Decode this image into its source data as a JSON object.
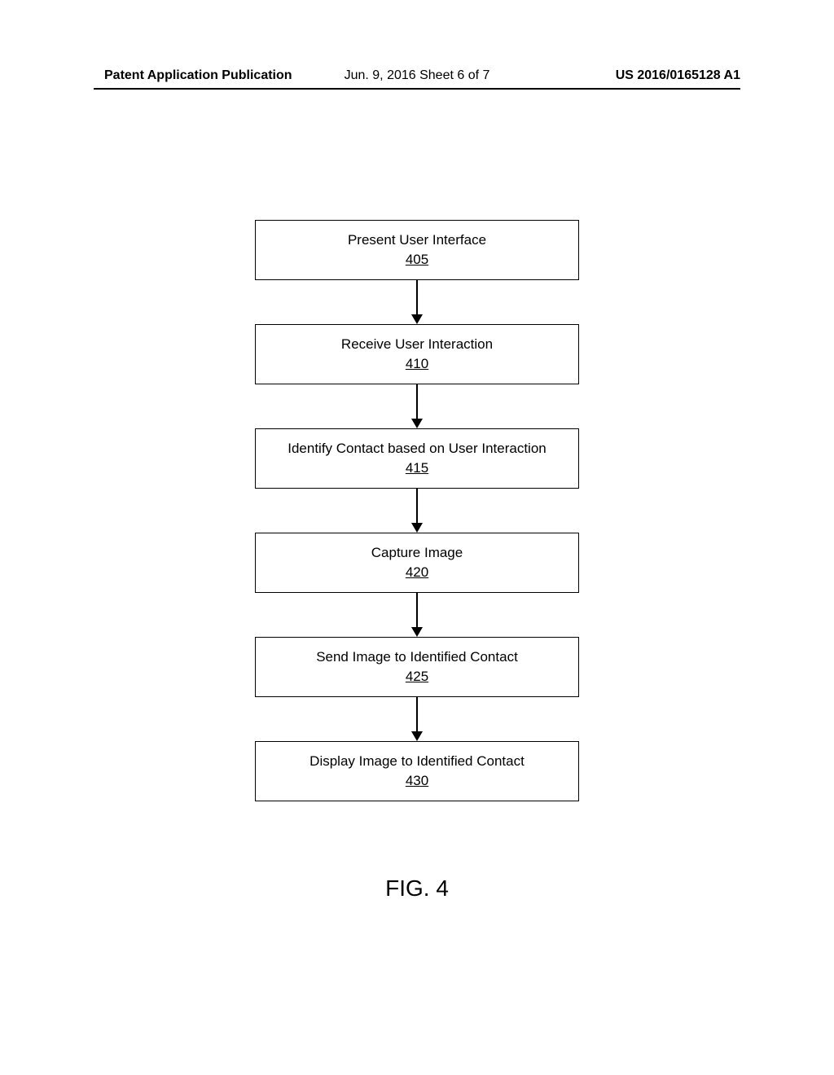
{
  "header": {
    "left": "Patent Application Publication",
    "center": "Jun. 9, 2016  Sheet 6 of 7",
    "right": "US 2016/0165128 A1"
  },
  "flowchart": {
    "steps": [
      {
        "label": "Present User Interface",
        "ref": "405"
      },
      {
        "label": "Receive User Interaction",
        "ref": "410"
      },
      {
        "label": "Identify Contact based on User Interaction",
        "ref": "415"
      },
      {
        "label": "Capture Image",
        "ref": "420"
      },
      {
        "label": "Send Image to Identified Contact",
        "ref": "425"
      },
      {
        "label": "Display Image to Identified Contact",
        "ref": "430"
      }
    ]
  },
  "figure_label": "FIG. 4"
}
